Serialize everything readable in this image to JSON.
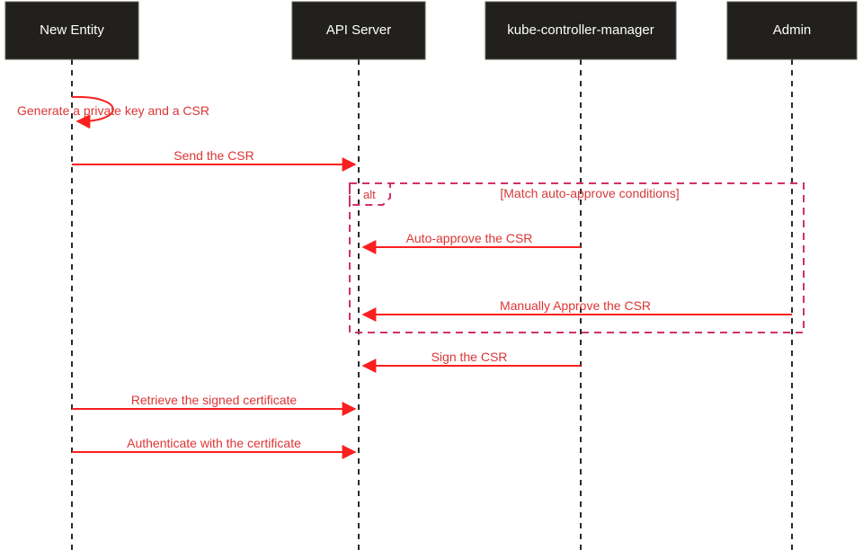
{
  "actors": {
    "newEntity": "New Entity",
    "apiServer": "API Server",
    "kcm": "kube-controller-manager",
    "admin": "Admin"
  },
  "messages": {
    "genKey": "Generate a private key and a CSR",
    "sendCSR": "Send the CSR",
    "autoApprove": "Auto-approve the CSR",
    "manualApprove": "Manually Approve the CSR",
    "signCSR": "Sign the CSR",
    "retrieve": "Retrieve the signed certificate",
    "authenticate": "Authenticate with the certificate"
  },
  "alt": {
    "label": "alt",
    "condition": "[Match auto-approve conditions]"
  },
  "chart_data": {
    "type": "sequence-diagram",
    "actors": [
      "New Entity",
      "API Server",
      "kube-controller-manager",
      "Admin"
    ],
    "steps": [
      {
        "from": "New Entity",
        "to": "New Entity",
        "label": "Generate a private key and a CSR",
        "self": true
      },
      {
        "from": "New Entity",
        "to": "API Server",
        "label": "Send the CSR"
      },
      {
        "alt": {
          "label": "alt",
          "condition": "[Match auto-approve conditions]",
          "branches": [
            [
              {
                "from": "kube-controller-manager",
                "to": "API Server",
                "label": "Auto-approve the CSR"
              }
            ],
            [
              {
                "from": "Admin",
                "to": "API Server",
                "label": "Manually Approve the CSR"
              }
            ]
          ]
        }
      },
      {
        "from": "kube-controller-manager",
        "to": "API Server",
        "label": "Sign the CSR"
      },
      {
        "from": "New Entity",
        "to": "API Server",
        "label": "Retrieve the signed certificate"
      },
      {
        "from": "New Entity",
        "to": "API Server",
        "label": "Authenticate with the certificate"
      }
    ]
  }
}
